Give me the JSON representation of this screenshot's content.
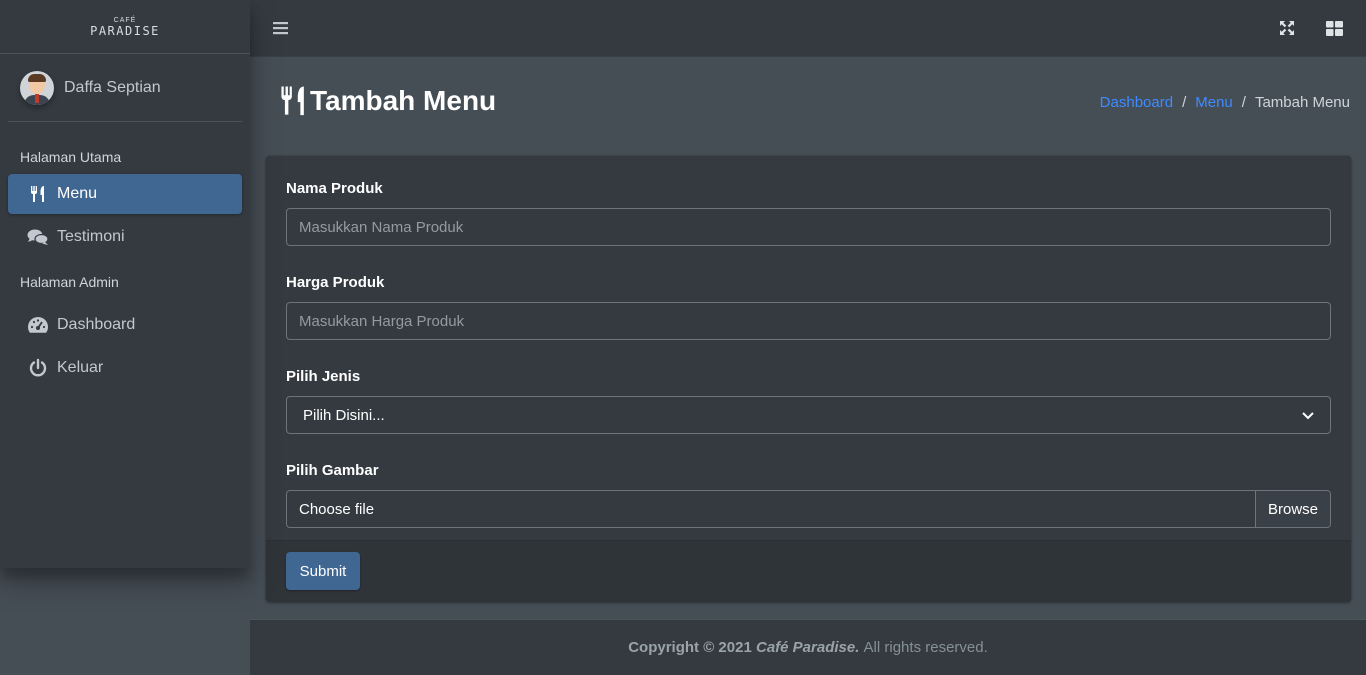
{
  "brand": {
    "top": "CAFÉ",
    "main": "PARADISE"
  },
  "user": {
    "name": "Daffa Septian"
  },
  "sidebar": {
    "header_main": "Halaman Utama",
    "header_admin": "Halaman Admin",
    "items": [
      {
        "label": "Menu",
        "icon": "utensils-icon",
        "active": true
      },
      {
        "label": "Testimoni",
        "icon": "comments-icon"
      },
      {
        "label": "Dashboard",
        "icon": "tachometer-icon"
      },
      {
        "label": "Keluar",
        "icon": "power-icon"
      }
    ]
  },
  "page": {
    "title": "Tambah Menu",
    "icon": "utensils-icon"
  },
  "breadcrumb": [
    "Dashboard",
    "Menu",
    "Tambah Menu"
  ],
  "form": {
    "nama_label": "Nama Produk",
    "nama_placeholder": "Masukkan Nama Produk",
    "harga_label": "Harga Produk",
    "harga_placeholder": "Masukkan Harga Produk",
    "jenis_label": "Pilih Jenis",
    "jenis_selected": "Pilih Disini...",
    "gambar_label": "Pilih Gambar",
    "file_text": "Choose file",
    "browse_label": "Browse",
    "submit_label": "Submit"
  },
  "footer": {
    "copyright": "Copyright © 2021",
    "brand": "Café Paradise.",
    "rights": "All rights reserved."
  },
  "colors": {
    "sidebar_bg": "#343a40",
    "content_bg": "#454d55",
    "active_item": "#3f6791",
    "link": "#3f8cff"
  }
}
